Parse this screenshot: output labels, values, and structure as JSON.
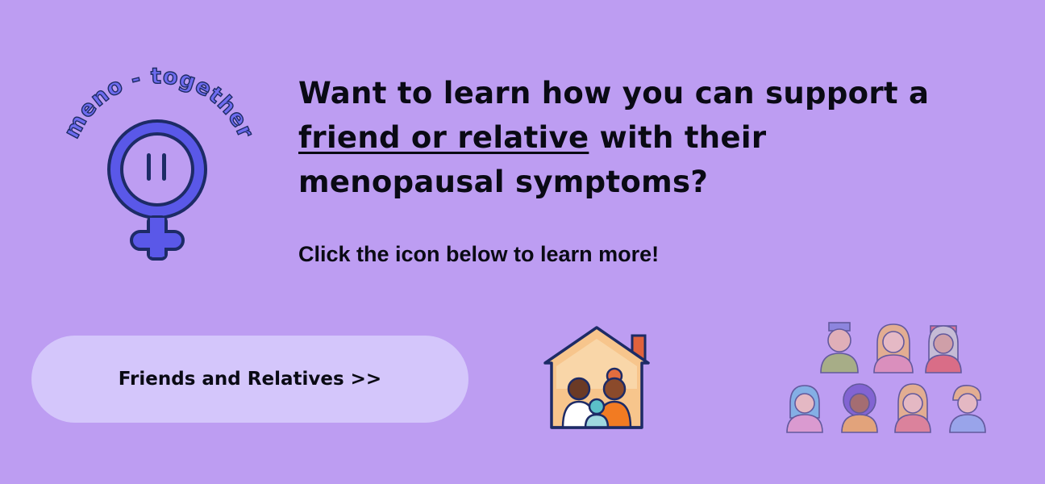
{
  "logo": {
    "text": "meno - together"
  },
  "headline": {
    "part1": "Want to learn how you can support a ",
    "link": "friend or relative",
    "part2": " with their menopausal symptoms?"
  },
  "subtext": "Click the icon below to learn more!",
  "cta_button": {
    "label": "Friends and Relatives >>"
  },
  "icons": {
    "logo": "venus-face-icon",
    "house": "family-house-icon",
    "group": "people-group-icon"
  },
  "colors": {
    "background": "#bd9df2",
    "button": "#d4c6fb",
    "logo_blue": "#5a58e8",
    "navy": "#1d2b66"
  }
}
